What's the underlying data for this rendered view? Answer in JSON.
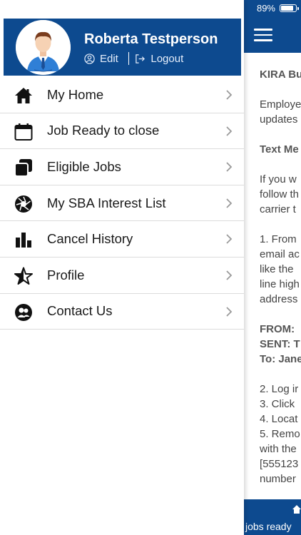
{
  "status_bar": {
    "battery_percent": "89%",
    "battery_level": 0.89
  },
  "user": {
    "name": "Roberta Testperson",
    "edit_label": "Edit",
    "logout_label": "Logout"
  },
  "menu": {
    "items": [
      {
        "label": "My Home",
        "icon": "home-icon"
      },
      {
        "label": "Job Ready to close",
        "icon": "calendar-icon"
      },
      {
        "label": "Eligible Jobs",
        "icon": "stacked-squares-icon"
      },
      {
        "label": "My SBA Interest List",
        "icon": "aperture-icon"
      },
      {
        "label": "Cancel History",
        "icon": "bar-chart-icon"
      },
      {
        "label": "Profile",
        "icon": "star-icon"
      },
      {
        "label": "Contact Us",
        "icon": "users-icon"
      }
    ]
  },
  "background": {
    "lines": [
      {
        "text": "KIRA Bu",
        "bold": true
      },
      {
        "text": "Employe",
        "bold": false
      },
      {
        "text": "updates",
        "bold": false
      },
      {
        "text": "Text Me",
        "bold": true
      },
      {
        "text": "If you w",
        "bold": false
      },
      {
        "text": "follow th",
        "bold": false
      },
      {
        "text": "carrier t",
        "bold": false
      },
      {
        "text": "1. From",
        "bold": false
      },
      {
        "text": "email ac",
        "bold": false
      },
      {
        "text": "like the",
        "bold": false
      },
      {
        "text": "line high",
        "bold": false
      },
      {
        "text": "address",
        "bold": false
      },
      {
        "text": "FROM:",
        "bold": true
      },
      {
        "text": "SENT: T",
        "bold": true
      },
      {
        "text": "To: Jane",
        "bold": true
      },
      {
        "text": "2. Log ir",
        "bold": false
      },
      {
        "text": "3. Click",
        "bold": false
      },
      {
        "text": "4. Locat",
        "bold": false
      },
      {
        "text": "5. Remo",
        "bold": false
      },
      {
        "text": "with the",
        "bold": false
      },
      {
        "text": "[555123",
        "bold": false
      },
      {
        "text": "number",
        "bold": false
      }
    ],
    "bottom_label": "jobs ready"
  },
  "colors": {
    "brand": "#0d4a8f"
  }
}
